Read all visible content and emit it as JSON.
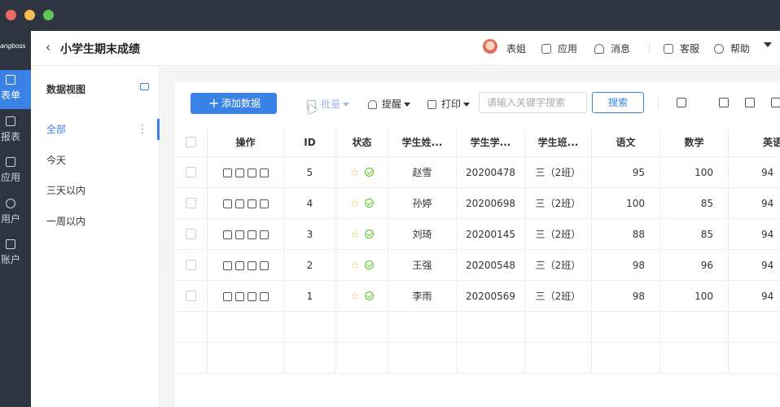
{
  "window": {
    "controls": [
      "close",
      "minimize",
      "maximize"
    ]
  },
  "rail": {
    "logo": "angboss",
    "items": [
      {
        "label": "表单",
        "icon": "form-icon",
        "active": true
      },
      {
        "label": "报表",
        "icon": "chart-icon",
        "active": false
      },
      {
        "label": "应用",
        "icon": "app-icon",
        "active": false
      },
      {
        "label": "用户",
        "icon": "user-icon",
        "active": false
      },
      {
        "label": "账户",
        "icon": "account-icon",
        "active": false
      }
    ]
  },
  "header": {
    "title": "小学生期末成绩",
    "user": "表姐",
    "apps": "应用",
    "messages": "消息",
    "service": "客服",
    "help": "帮助"
  },
  "side": {
    "title": "数据视图",
    "items": [
      "全部",
      "今天",
      "三天以内",
      "一周以内"
    ],
    "active_index": 0
  },
  "toolbar": {
    "add_label": "添加数据",
    "batch_label": "批量",
    "remind_label": "提醒",
    "print_label": "打印",
    "search_placeholder": "请输入关键字搜索",
    "search_label": "搜索"
  },
  "table": {
    "columns": [
      "操作",
      "ID",
      "状态",
      "学生姓...",
      "学生学...",
      "学生班...",
      "语文",
      "数学",
      "英语"
    ],
    "rows": [
      {
        "id": "5",
        "name": "赵雪",
        "student_no": "20200478",
        "class": "三（2班）",
        "chinese": "95",
        "math": "100",
        "english": "94"
      },
      {
        "id": "4",
        "name": "孙婷",
        "student_no": "20200698",
        "class": "三（2班）",
        "chinese": "100",
        "math": "85",
        "english": "94"
      },
      {
        "id": "3",
        "name": "刘琦",
        "student_no": "20200145",
        "class": "三（2班）",
        "chinese": "88",
        "math": "85",
        "english": "94"
      },
      {
        "id": "2",
        "name": "王强",
        "student_no": "20200548",
        "class": "三（2班）",
        "chinese": "98",
        "math": "96",
        "english": "94"
      },
      {
        "id": "1",
        "name": "李雨",
        "student_no": "20200569",
        "class": "三（2班）",
        "chinese": "98",
        "math": "100",
        "english": "94"
      }
    ]
  },
  "colors": {
    "accent": "#3b82e6",
    "rail": "#2e3440",
    "titlebar": "#2f3441",
    "star": "#e8b84a",
    "ok": "#52c41a"
  }
}
